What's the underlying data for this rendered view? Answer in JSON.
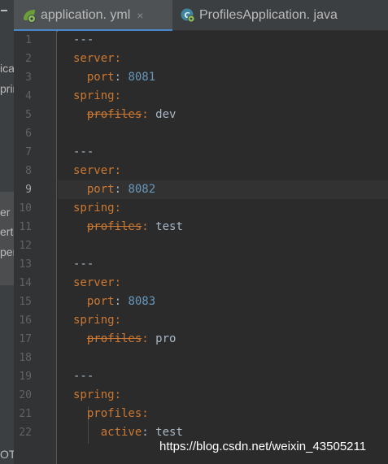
{
  "left_panel": {
    "items": [
      {
        "text": "ica"
      },
      {
        "text": "prin"
      },
      {
        "text": "er"
      },
      {
        "text": "ert"
      },
      {
        "text": "per"
      },
      {
        "text": "OT"
      }
    ]
  },
  "tabs": [
    {
      "label": "application. yml",
      "icon": "spring-yaml-file-icon",
      "active": true,
      "close": "×"
    },
    {
      "label": "ProfilesApplication. java",
      "icon": "spring-boot-class-icon",
      "active": false
    }
  ],
  "line_numbers": [
    "1",
    "2",
    "3",
    "4",
    "5",
    "6",
    "7",
    "8",
    "9",
    "10",
    "11",
    "12",
    "13",
    "14",
    "15",
    "16",
    "17",
    "18",
    "19",
    "20",
    "21",
    "22"
  ],
  "current_line": "9",
  "code": [
    {
      "indent": "",
      "parts": [
        {
          "t": "---",
          "c": "plain"
        }
      ]
    },
    {
      "indent": "",
      "parts": [
        {
          "t": "server",
          "c": "key"
        },
        {
          "t": ":",
          "c": "key"
        }
      ]
    },
    {
      "indent": "  ",
      "parts": [
        {
          "t": "port",
          "c": "key"
        },
        {
          "t": ": ",
          "c": "plain"
        },
        {
          "t": "8081",
          "c": "num"
        }
      ]
    },
    {
      "indent": "",
      "parts": [
        {
          "t": "spring",
          "c": "key"
        },
        {
          "t": ":",
          "c": "key"
        }
      ]
    },
    {
      "indent": "  ",
      "parts": [
        {
          "t": "profiles",
          "c": "strike"
        },
        {
          "t": ":",
          "c": "key"
        },
        {
          "t": " dev",
          "c": "plain"
        }
      ]
    },
    {
      "indent": "",
      "parts": []
    },
    {
      "indent": "",
      "parts": [
        {
          "t": "---",
          "c": "plain"
        }
      ]
    },
    {
      "indent": "",
      "parts": [
        {
          "t": "server",
          "c": "key"
        },
        {
          "t": ":",
          "c": "key"
        }
      ]
    },
    {
      "indent": "  ",
      "parts": [
        {
          "t": "port",
          "c": "key"
        },
        {
          "t": ": ",
          "c": "plain"
        },
        {
          "t": "8082",
          "c": "num"
        }
      ]
    },
    {
      "indent": "",
      "parts": [
        {
          "t": "spring",
          "c": "key"
        },
        {
          "t": ":",
          "c": "key"
        }
      ]
    },
    {
      "indent": "  ",
      "parts": [
        {
          "t": "profiles",
          "c": "strike"
        },
        {
          "t": ":",
          "c": "key"
        },
        {
          "t": " test",
          "c": "plain"
        }
      ]
    },
    {
      "indent": "",
      "parts": []
    },
    {
      "indent": "",
      "parts": [
        {
          "t": "---",
          "c": "plain"
        }
      ]
    },
    {
      "indent": "",
      "parts": [
        {
          "t": "server",
          "c": "key"
        },
        {
          "t": ":",
          "c": "key"
        }
      ]
    },
    {
      "indent": "  ",
      "parts": [
        {
          "t": "port",
          "c": "key"
        },
        {
          "t": ": ",
          "c": "plain"
        },
        {
          "t": "8083",
          "c": "num"
        }
      ]
    },
    {
      "indent": "",
      "parts": [
        {
          "t": "spring",
          "c": "key"
        },
        {
          "t": ":",
          "c": "key"
        }
      ]
    },
    {
      "indent": "  ",
      "parts": [
        {
          "t": "profiles",
          "c": "strike"
        },
        {
          "t": ":",
          "c": "key"
        },
        {
          "t": " pro",
          "c": "plain"
        }
      ]
    },
    {
      "indent": "",
      "parts": []
    },
    {
      "indent": "",
      "parts": [
        {
          "t": "---",
          "c": "plain"
        }
      ]
    },
    {
      "indent": "",
      "parts": [
        {
          "t": "spring",
          "c": "key"
        },
        {
          "t": ":",
          "c": "key"
        }
      ]
    },
    {
      "indent": "  ",
      "parts": [
        {
          "t": "profiles",
          "c": "key"
        },
        {
          "t": ":",
          "c": "key"
        }
      ]
    },
    {
      "indent": "    ",
      "parts": [
        {
          "t": "active",
          "c": "key"
        },
        {
          "t": ": ",
          "c": "plain"
        },
        {
          "t": "test",
          "c": "plain"
        }
      ]
    }
  ],
  "watermark": "https://blog.csdn.net/weixin_43505211",
  "colors": {
    "background": "#2b2b2b",
    "keyword": "#cc7832",
    "number": "#6897bb",
    "text": "#a9b7c6",
    "tab_accent": "#4a88c7"
  }
}
